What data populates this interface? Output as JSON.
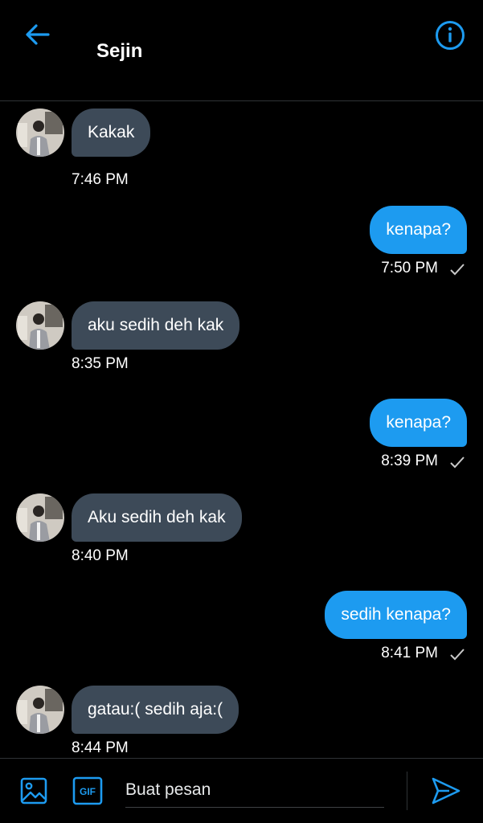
{
  "header": {
    "title": "Sejin",
    "back_icon": "arrow-left-icon",
    "info_icon": "info-icon"
  },
  "colors": {
    "background": "#000000",
    "accent": "#1d9bf0",
    "incoming_bubble": "#3d4a58"
  },
  "messages": [
    {
      "direction": "incoming",
      "text": "Kakak",
      "time": "7:46 PM"
    },
    {
      "direction": "outgoing",
      "text": "kenapa?",
      "time": "7:50 PM"
    },
    {
      "direction": "incoming",
      "text": "aku sedih deh kak",
      "time": "8:35 PM"
    },
    {
      "direction": "outgoing",
      "text": "kenapa?",
      "time": "8:39 PM"
    },
    {
      "direction": "incoming",
      "text": "Aku sedih deh kak",
      "time": "8:40 PM"
    },
    {
      "direction": "outgoing",
      "text": "sedih kenapa?",
      "time": "8:41 PM"
    },
    {
      "direction": "incoming",
      "text": "gatau:( sedih aja:(",
      "time": "8:44 PM"
    }
  ],
  "composer": {
    "placeholder": "Buat pesan",
    "value": "",
    "image_icon": "image-icon",
    "gif_label": "GIF",
    "send_icon": "send-icon"
  }
}
